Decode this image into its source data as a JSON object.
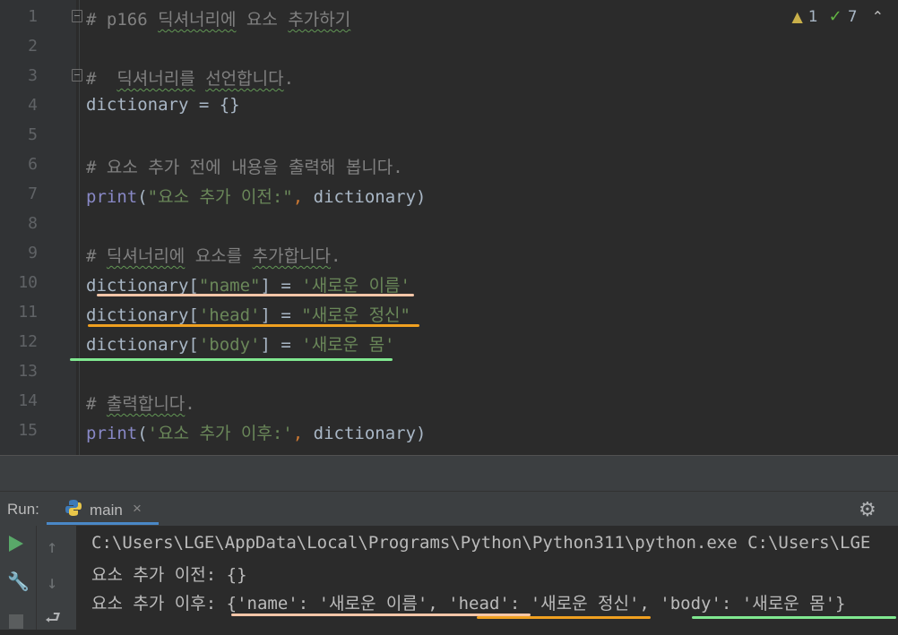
{
  "editor": {
    "lines": [
      {
        "num": "1",
        "parts": [
          {
            "t": "# p166 ",
            "c": "comment"
          },
          {
            "t": "딕셔너리에",
            "c": "comment squig"
          },
          {
            "t": " 요소 ",
            "c": "comment"
          },
          {
            "t": "추가하기",
            "c": "comment squig"
          }
        ]
      },
      {
        "num": "2",
        "parts": []
      },
      {
        "num": "3",
        "parts": [
          {
            "t": "#  ",
            "c": "comment"
          },
          {
            "t": "딕셔너리를",
            "c": "comment squig"
          },
          {
            "t": " ",
            "c": "comment"
          },
          {
            "t": "선언합니다",
            "c": "comment squig"
          },
          {
            "t": ".",
            "c": "comment"
          }
        ]
      },
      {
        "num": "4",
        "parts": [
          {
            "t": "dictionary = {}",
            "c": "ident"
          }
        ]
      },
      {
        "num": "5",
        "parts": []
      },
      {
        "num": "6",
        "parts": [
          {
            "t": "# 요소 추가 전에 내용을 출력해 봅니다.",
            "c": "comment"
          }
        ]
      },
      {
        "num": "7",
        "parts": [
          {
            "t": "print",
            "c": "builtin"
          },
          {
            "t": "(",
            "c": "ident"
          },
          {
            "t": "\"요소 추가 이전:\"",
            "c": "str"
          },
          {
            "t": ", ",
            "c": "punct"
          },
          {
            "t": "dictionary)",
            "c": "ident"
          }
        ]
      },
      {
        "num": "8",
        "parts": []
      },
      {
        "num": "9",
        "parts": [
          {
            "t": "# ",
            "c": "comment"
          },
          {
            "t": "딕셔너리에",
            "c": "comment squig"
          },
          {
            "t": " 요소를 ",
            "c": "comment"
          },
          {
            "t": "추가합니다",
            "c": "comment squig"
          },
          {
            "t": ".",
            "c": "comment"
          }
        ]
      },
      {
        "num": "10",
        "parts": [
          {
            "t": "dictionary[",
            "c": "ident"
          },
          {
            "t": "\"name\"",
            "c": "str"
          },
          {
            "t": "] = ",
            "c": "ident"
          },
          {
            "t": "'새로운 이름'",
            "c": "str"
          }
        ]
      },
      {
        "num": "11",
        "parts": [
          {
            "t": "dictionary[",
            "c": "ident"
          },
          {
            "t": "'head'",
            "c": "str"
          },
          {
            "t": "] = ",
            "c": "ident"
          },
          {
            "t": "\"새로운 정신\"",
            "c": "str"
          }
        ]
      },
      {
        "num": "12",
        "parts": [
          {
            "t": "dictionary[",
            "c": "ident"
          },
          {
            "t": "'body'",
            "c": "str"
          },
          {
            "t": "] = ",
            "c": "ident"
          },
          {
            "t": "'새로운 몸'",
            "c": "str"
          }
        ]
      },
      {
        "num": "13",
        "parts": []
      },
      {
        "num": "14",
        "parts": [
          {
            "t": "# ",
            "c": "comment"
          },
          {
            "t": "출력합니다",
            "c": "comment squig"
          },
          {
            "t": ".",
            "c": "comment"
          }
        ]
      },
      {
        "num": "15",
        "parts": [
          {
            "t": "print",
            "c": "builtin"
          },
          {
            "t": "(",
            "c": "ident"
          },
          {
            "t": "'요소 추가 이후:'",
            "c": "str"
          },
          {
            "t": ", ",
            "c": "punct"
          },
          {
            "t": "dictionary)",
            "c": "ident"
          }
        ]
      }
    ],
    "inspections": {
      "warnings": "1",
      "ok": "7"
    }
  },
  "run": {
    "label": "Run:",
    "tab": "main",
    "output": [
      "C:\\Users\\LGE\\AppData\\Local\\Programs\\Python\\Python311\\python.exe C:\\Users\\LGE",
      "요소 추가 이전: {}",
      "요소 추가 이후: {'name': '새로운 이름', 'head': '새로운 정신', 'body': '새로운 몸'}"
    ]
  },
  "colors": {
    "underline_name": "#f5c6a8",
    "underline_head": "#f0a020",
    "underline_body": "#80e890"
  }
}
